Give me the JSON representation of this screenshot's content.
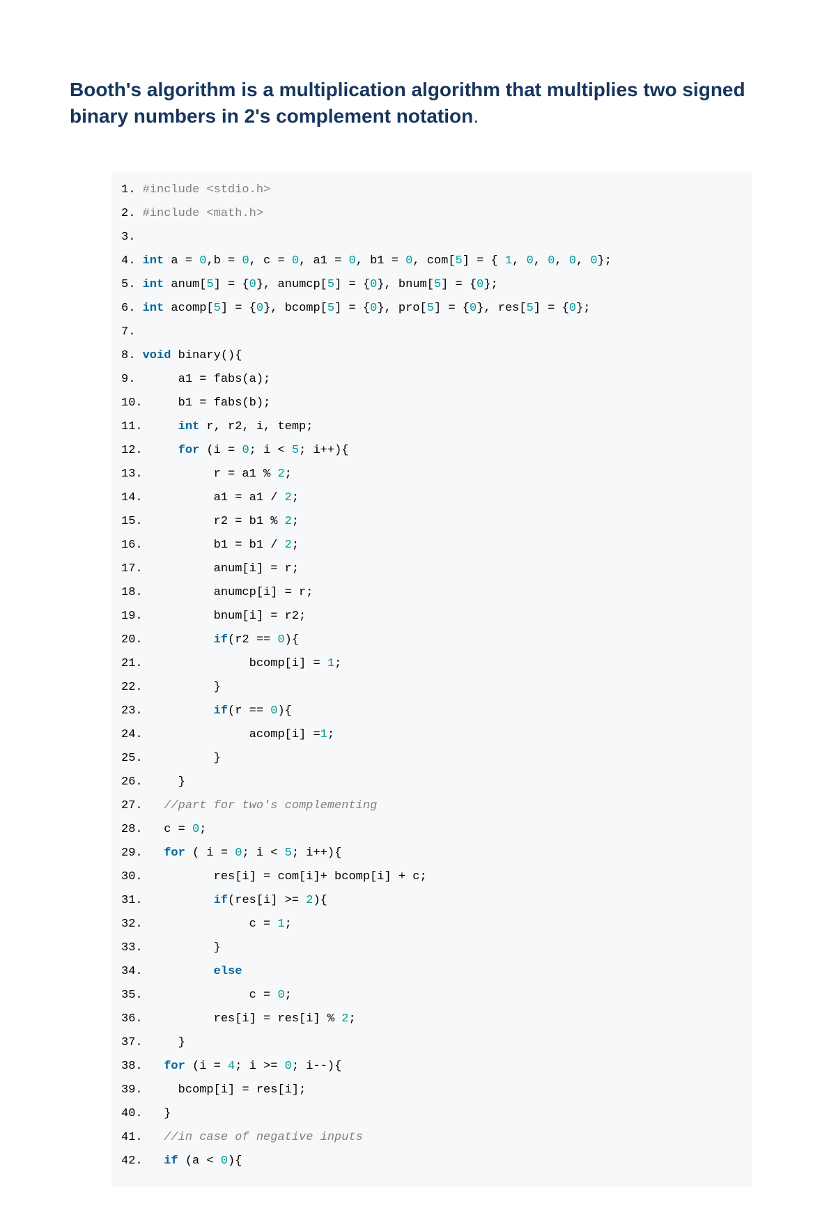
{
  "title": "Booth's algorithm is a multiplication algorithm that multiplies two signed binary numbers in 2's complement notation",
  "title_trailing_dot": ".",
  "code": {
    "lines": [
      {
        "n": "1",
        "segs": [
          {
            "c": "pp",
            "t": "#include <stdio.h>"
          }
        ]
      },
      {
        "n": "2",
        "segs": [
          {
            "c": "pp",
            "t": "#include <math.h>"
          }
        ]
      },
      {
        "n": "3",
        "segs": []
      },
      {
        "n": "4",
        "segs": [
          {
            "c": "kw",
            "t": "int"
          },
          {
            "c": "id",
            "t": " a = "
          },
          {
            "c": "num",
            "t": "0"
          },
          {
            "c": "id",
            "t": ",b = "
          },
          {
            "c": "num",
            "t": "0"
          },
          {
            "c": "id",
            "t": ", c = "
          },
          {
            "c": "num",
            "t": "0"
          },
          {
            "c": "id",
            "t": ", a1 = "
          },
          {
            "c": "num",
            "t": "0"
          },
          {
            "c": "id",
            "t": ", b1 = "
          },
          {
            "c": "num",
            "t": "0"
          },
          {
            "c": "id",
            "t": ", com["
          },
          {
            "c": "num",
            "t": "5"
          },
          {
            "c": "id",
            "t": "] = { "
          },
          {
            "c": "num",
            "t": "1"
          },
          {
            "c": "id",
            "t": ", "
          },
          {
            "c": "num",
            "t": "0"
          },
          {
            "c": "id",
            "t": ", "
          },
          {
            "c": "num",
            "t": "0"
          },
          {
            "c": "id",
            "t": ", "
          },
          {
            "c": "num",
            "t": "0"
          },
          {
            "c": "id",
            "t": ", "
          },
          {
            "c": "num",
            "t": "0"
          },
          {
            "c": "id",
            "t": "};"
          }
        ]
      },
      {
        "n": "5",
        "segs": [
          {
            "c": "kw",
            "t": "int"
          },
          {
            "c": "id",
            "t": " anum["
          },
          {
            "c": "num",
            "t": "5"
          },
          {
            "c": "id",
            "t": "] = {"
          },
          {
            "c": "num",
            "t": "0"
          },
          {
            "c": "id",
            "t": "}, anumcp["
          },
          {
            "c": "num",
            "t": "5"
          },
          {
            "c": "id",
            "t": "] = {"
          },
          {
            "c": "num",
            "t": "0"
          },
          {
            "c": "id",
            "t": "}, bnum["
          },
          {
            "c": "num",
            "t": "5"
          },
          {
            "c": "id",
            "t": "] = {"
          },
          {
            "c": "num",
            "t": "0"
          },
          {
            "c": "id",
            "t": "};"
          }
        ]
      },
      {
        "n": "6",
        "segs": [
          {
            "c": "kw",
            "t": "int"
          },
          {
            "c": "id",
            "t": " acomp["
          },
          {
            "c": "num",
            "t": "5"
          },
          {
            "c": "id",
            "t": "] = {"
          },
          {
            "c": "num",
            "t": "0"
          },
          {
            "c": "id",
            "t": "}, bcomp["
          },
          {
            "c": "num",
            "t": "5"
          },
          {
            "c": "id",
            "t": "] = {"
          },
          {
            "c": "num",
            "t": "0"
          },
          {
            "c": "id",
            "t": "}, pro["
          },
          {
            "c": "num",
            "t": "5"
          },
          {
            "c": "id",
            "t": "] = {"
          },
          {
            "c": "num",
            "t": "0"
          },
          {
            "c": "id",
            "t": "}, res["
          },
          {
            "c": "num",
            "t": "5"
          },
          {
            "c": "id",
            "t": "] = {"
          },
          {
            "c": "num",
            "t": "0"
          },
          {
            "c": "id",
            "t": "};"
          }
        ]
      },
      {
        "n": "7",
        "segs": []
      },
      {
        "n": "8",
        "segs": [
          {
            "c": "kw",
            "t": "void"
          },
          {
            "c": "id",
            "t": " binary(){"
          }
        ]
      },
      {
        "n": "9",
        "segs": [
          {
            "c": "id",
            "t": "     a1 = fabs(a);"
          }
        ]
      },
      {
        "n": "10",
        "segs": [
          {
            "c": "id",
            "t": "    b1 = fabs(b);"
          }
        ]
      },
      {
        "n": "11",
        "segs": [
          {
            "c": "id",
            "t": "    "
          },
          {
            "c": "kw",
            "t": "int"
          },
          {
            "c": "id",
            "t": " r, r2, i, temp;"
          }
        ]
      },
      {
        "n": "12",
        "segs": [
          {
            "c": "id",
            "t": "    "
          },
          {
            "c": "kw",
            "t": "for"
          },
          {
            "c": "id",
            "t": " (i = "
          },
          {
            "c": "num",
            "t": "0"
          },
          {
            "c": "id",
            "t": "; i < "
          },
          {
            "c": "num",
            "t": "5"
          },
          {
            "c": "id",
            "t": "; i++){"
          }
        ]
      },
      {
        "n": "13",
        "segs": [
          {
            "c": "id",
            "t": "         r = a1 % "
          },
          {
            "c": "num",
            "t": "2"
          },
          {
            "c": "id",
            "t": ";"
          }
        ]
      },
      {
        "n": "14",
        "segs": [
          {
            "c": "id",
            "t": "         a1 = a1 / "
          },
          {
            "c": "num",
            "t": "2"
          },
          {
            "c": "id",
            "t": ";"
          }
        ]
      },
      {
        "n": "15",
        "segs": [
          {
            "c": "id",
            "t": "         r2 = b1 % "
          },
          {
            "c": "num",
            "t": "2"
          },
          {
            "c": "id",
            "t": ";"
          }
        ]
      },
      {
        "n": "16",
        "segs": [
          {
            "c": "id",
            "t": "         b1 = b1 / "
          },
          {
            "c": "num",
            "t": "2"
          },
          {
            "c": "id",
            "t": ";"
          }
        ]
      },
      {
        "n": "17",
        "segs": [
          {
            "c": "id",
            "t": "         anum[i] = r;"
          }
        ]
      },
      {
        "n": "18",
        "segs": [
          {
            "c": "id",
            "t": "         anumcp[i] = r;"
          }
        ]
      },
      {
        "n": "19",
        "segs": [
          {
            "c": "id",
            "t": "         bnum[i] = r2;"
          }
        ]
      },
      {
        "n": "20",
        "segs": [
          {
            "c": "id",
            "t": "         "
          },
          {
            "c": "kw",
            "t": "if"
          },
          {
            "c": "id",
            "t": "(r2 == "
          },
          {
            "c": "num",
            "t": "0"
          },
          {
            "c": "id",
            "t": "){"
          }
        ]
      },
      {
        "n": "21",
        "segs": [
          {
            "c": "id",
            "t": "              bcomp[i] = "
          },
          {
            "c": "num",
            "t": "1"
          },
          {
            "c": "id",
            "t": ";"
          }
        ]
      },
      {
        "n": "22",
        "segs": [
          {
            "c": "id",
            "t": "         }"
          }
        ]
      },
      {
        "n": "23",
        "segs": [
          {
            "c": "id",
            "t": "         "
          },
          {
            "c": "kw",
            "t": "if"
          },
          {
            "c": "id",
            "t": "(r == "
          },
          {
            "c": "num",
            "t": "0"
          },
          {
            "c": "id",
            "t": "){"
          }
        ]
      },
      {
        "n": "24",
        "segs": [
          {
            "c": "id",
            "t": "              acomp[i] ="
          },
          {
            "c": "num",
            "t": "1"
          },
          {
            "c": "id",
            "t": ";"
          }
        ]
      },
      {
        "n": "25",
        "segs": [
          {
            "c": "id",
            "t": "         }"
          }
        ]
      },
      {
        "n": "26",
        "segs": [
          {
            "c": "id",
            "t": "    }"
          }
        ]
      },
      {
        "n": "27",
        "segs": [
          {
            "c": "id",
            "t": "  "
          },
          {
            "c": "cm",
            "t": "//part for two's complementing"
          }
        ]
      },
      {
        "n": "28",
        "segs": [
          {
            "c": "id",
            "t": "  c = "
          },
          {
            "c": "num",
            "t": "0"
          },
          {
            "c": "id",
            "t": ";"
          }
        ]
      },
      {
        "n": "29",
        "segs": [
          {
            "c": "id",
            "t": "  "
          },
          {
            "c": "kw",
            "t": "for"
          },
          {
            "c": "id",
            "t": " ( i = "
          },
          {
            "c": "num",
            "t": "0"
          },
          {
            "c": "id",
            "t": "; i < "
          },
          {
            "c": "num",
            "t": "5"
          },
          {
            "c": "id",
            "t": "; i++){"
          }
        ]
      },
      {
        "n": "30",
        "segs": [
          {
            "c": "id",
            "t": "         res[i] = com[i]+ bcomp[i] + c;"
          }
        ]
      },
      {
        "n": "31",
        "segs": [
          {
            "c": "id",
            "t": "         "
          },
          {
            "c": "kw",
            "t": "if"
          },
          {
            "c": "id",
            "t": "(res[i] >= "
          },
          {
            "c": "num",
            "t": "2"
          },
          {
            "c": "id",
            "t": "){"
          }
        ]
      },
      {
        "n": "32",
        "segs": [
          {
            "c": "id",
            "t": "              c = "
          },
          {
            "c": "num",
            "t": "1"
          },
          {
            "c": "id",
            "t": ";"
          }
        ]
      },
      {
        "n": "33",
        "segs": [
          {
            "c": "id",
            "t": "         }"
          }
        ]
      },
      {
        "n": "34",
        "segs": [
          {
            "c": "id",
            "t": "         "
          },
          {
            "c": "kw",
            "t": "else"
          }
        ]
      },
      {
        "n": "35",
        "segs": [
          {
            "c": "id",
            "t": "              c = "
          },
          {
            "c": "num",
            "t": "0"
          },
          {
            "c": "id",
            "t": ";"
          }
        ]
      },
      {
        "n": "36",
        "segs": [
          {
            "c": "id",
            "t": "         res[i] = res[i] % "
          },
          {
            "c": "num",
            "t": "2"
          },
          {
            "c": "id",
            "t": ";"
          }
        ]
      },
      {
        "n": "37",
        "segs": [
          {
            "c": "id",
            "t": "    }"
          }
        ]
      },
      {
        "n": "38",
        "segs": [
          {
            "c": "id",
            "t": "  "
          },
          {
            "c": "kw",
            "t": "for"
          },
          {
            "c": "id",
            "t": " (i = "
          },
          {
            "c": "num",
            "t": "4"
          },
          {
            "c": "id",
            "t": "; i >= "
          },
          {
            "c": "num",
            "t": "0"
          },
          {
            "c": "id",
            "t": "; i--){"
          }
        ]
      },
      {
        "n": "39",
        "segs": [
          {
            "c": "id",
            "t": "    bcomp[i] = res[i];"
          }
        ]
      },
      {
        "n": "40",
        "segs": [
          {
            "c": "id",
            "t": "  }"
          }
        ]
      },
      {
        "n": "41",
        "segs": [
          {
            "c": "id",
            "t": "  "
          },
          {
            "c": "cm",
            "t": "//in case of negative inputs"
          }
        ]
      },
      {
        "n": "42",
        "segs": [
          {
            "c": "id",
            "t": "  "
          },
          {
            "c": "kw",
            "t": "if"
          },
          {
            "c": "id",
            "t": " (a < "
          },
          {
            "c": "num",
            "t": "0"
          },
          {
            "c": "id",
            "t": "){"
          }
        ]
      }
    ]
  }
}
